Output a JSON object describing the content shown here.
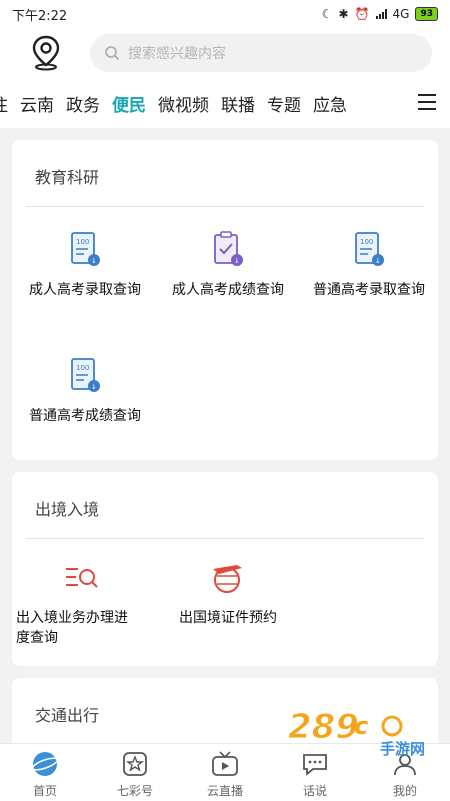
{
  "status_bar": {
    "time": "下午2:22",
    "network": "4G",
    "battery": "93"
  },
  "header": {
    "search_placeholder": "搜索感兴趣内容"
  },
  "tabs": [
    "注",
    "云南",
    "政务",
    "便民",
    "微视频",
    "联播",
    "专题",
    "应急"
  ],
  "active_tab": "便民",
  "sections": [
    {
      "title": "教育科研",
      "items": [
        "成人高考录取查询",
        "成人高考成绩查询",
        "普通高考录取查询",
        "普通高考成绩查询"
      ]
    },
    {
      "title": "出境入境",
      "items": [
        "出入境业务办理进",
        "度查询",
        "出国境证件预约"
      ]
    },
    {
      "title": "交通出行"
    }
  ],
  "bottom_nav": [
    "首页",
    "七彩号",
    "云直播",
    "话说",
    "我的"
  ],
  "watermark": {
    "number": "289",
    "suffix": "c",
    "text": "手游网"
  },
  "colors": {
    "accent": "#1aa6b3",
    "icon_blue": "#3a7fc8",
    "icon_purple": "#7b5fc6",
    "icon_red": "#e04a3b"
  }
}
